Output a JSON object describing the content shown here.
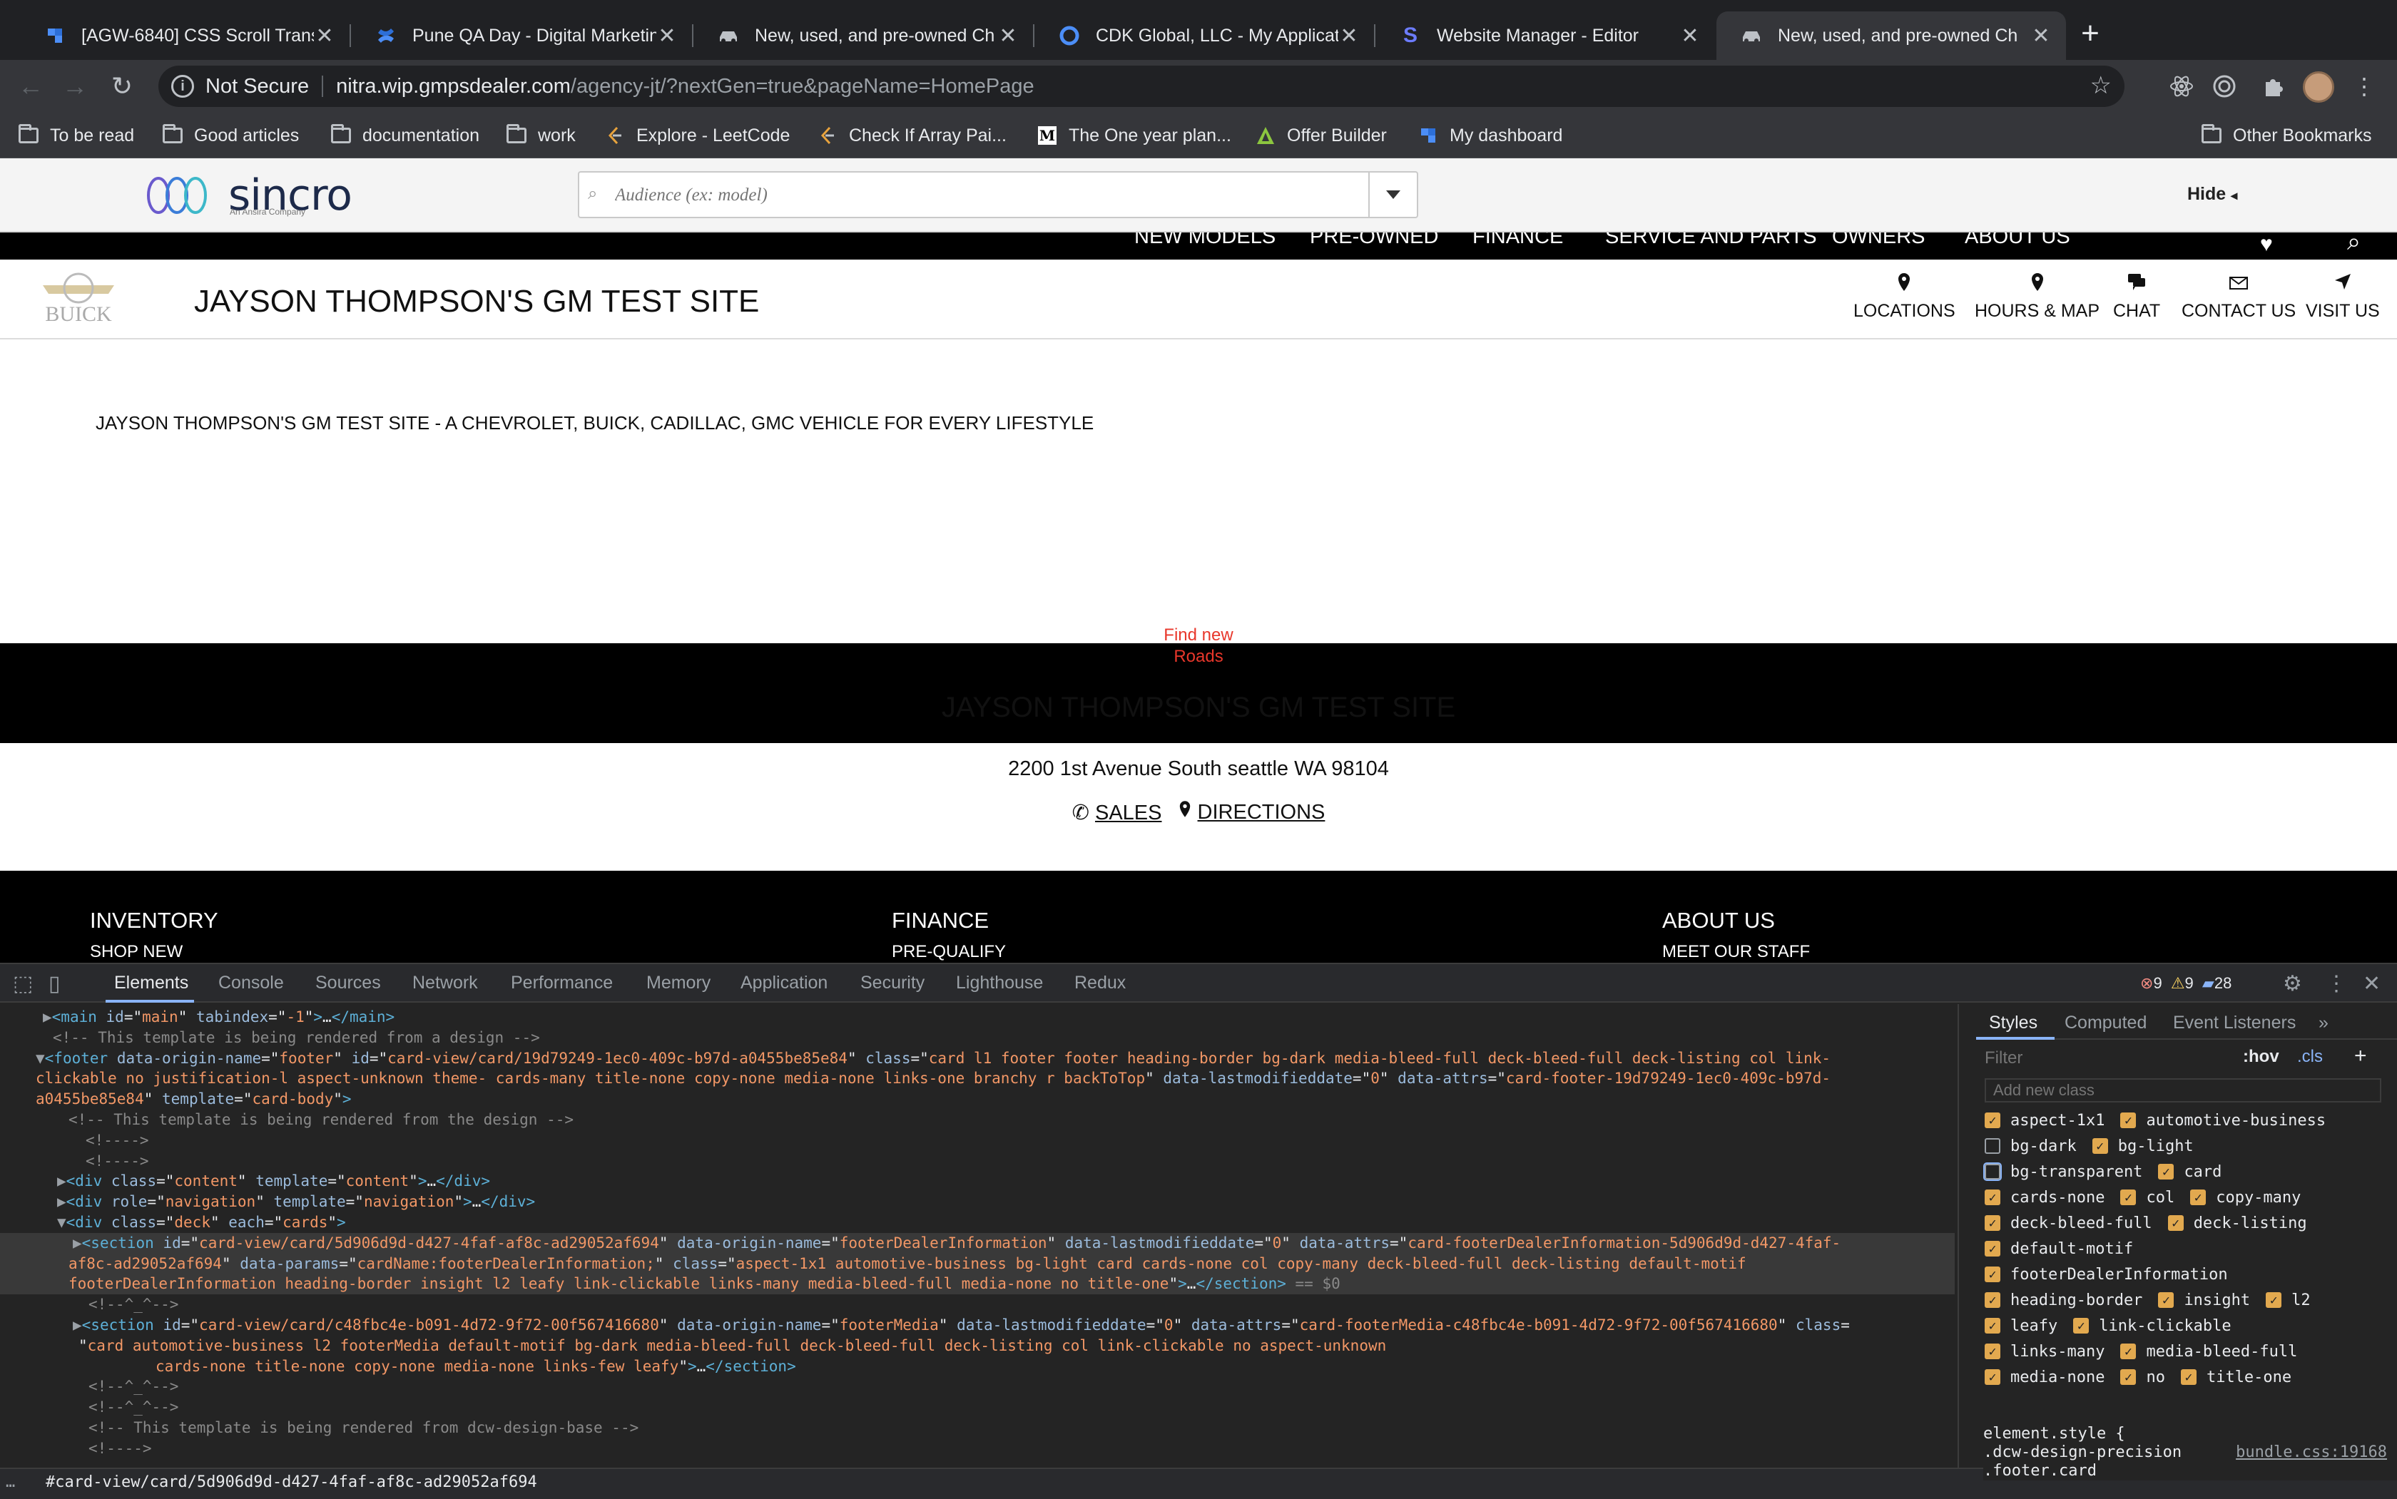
{
  "browser": {
    "tabs": [
      {
        "title": "[AGW-6840] CSS Scroll Transi",
        "favicon": "jira-icon"
      },
      {
        "title": "Pune QA Day - Digital Marketin",
        "favicon": "confluence-icon"
      },
      {
        "title": "New, used, and pre-owned Ch",
        "favicon": "car-icon"
      },
      {
        "title": "CDK Global, LLC - My Applicat",
        "favicon": "cdk-icon"
      },
      {
        "title": "Website Manager - Editor",
        "favicon": "s-logo-icon"
      },
      {
        "title": "New, used, and pre-owned Ch",
        "favicon": "car-icon",
        "active": true
      }
    ],
    "security_label": "Not Secure",
    "url_host": "nitra.wip.gmpsdealer.com",
    "url_path": "/agency-jt/?nextGen=true&pageName=HomePage",
    "bookmarks": [
      {
        "label": "To be read",
        "icon": "folder-icon"
      },
      {
        "label": "Good articles",
        "icon": "folder-icon"
      },
      {
        "label": "documentation",
        "icon": "folder-icon"
      },
      {
        "label": "work",
        "icon": "folder-icon"
      },
      {
        "label": "Explore - LeetCode",
        "icon": "leetcode-icon"
      },
      {
        "label": "Check If Array Pai...",
        "icon": "leetcode-icon"
      },
      {
        "label": "The One year plan...",
        "icon": "medium-icon"
      },
      {
        "label": "Offer Builder",
        "icon": "offer-builder-icon"
      },
      {
        "label": "My dashboard",
        "icon": "jira-icon"
      }
    ],
    "other_bookmarks": "Other Bookmarks"
  },
  "page": {
    "sincro_word": "sincro",
    "sincro_sub": "An Ansira Company",
    "audience_placeholder": "Audience (ex: model)",
    "hide_label": "Hide",
    "topnav": [
      "NEW MODELS",
      "PRE-OWNED",
      "FINANCE",
      "SERVICE AND PARTS",
      "OWNERS",
      "ABOUT US"
    ],
    "dealer_logo_text": "BUICK",
    "dealer_name": "JAYSON THOMPSON'S GM TEST SITE",
    "utility_links": [
      {
        "label": "LOCATIONS",
        "icon": "map-pin-icon"
      },
      {
        "label": "HOURS & MAP",
        "icon": "map-pin-icon"
      },
      {
        "label": "CHAT",
        "icon": "chat-icon"
      },
      {
        "label": "CONTACT US",
        "icon": "envelope-icon"
      },
      {
        "label": "VISIT US",
        "icon": "navigation-arrow-icon"
      }
    ],
    "tagline": "JAYSON THOMPSON'S GM TEST SITE - A CHEVROLET, BUICK, CADILLAC, GMC VEHICLE FOR EVERY LIFESTYLE",
    "find_new_line1": "Find new",
    "find_new_line2": "Roads",
    "info_name": "JAYSON THOMPSON'S GM TEST SITE",
    "address": "2200 1st Avenue South seattle WA 98104",
    "sales_label": "SALES",
    "directions_label": "DIRECTIONS",
    "footer_cols": [
      {
        "heading": "INVENTORY",
        "first_link": "SHOP NEW"
      },
      {
        "heading": "FINANCE",
        "first_link": "PRE-QUALIFY"
      },
      {
        "heading": "ABOUT US",
        "first_link": "MEET OUR STAFF"
      }
    ]
  },
  "devtools": {
    "tabs": [
      "Elements",
      "Console",
      "Sources",
      "Network",
      "Performance",
      "Memory",
      "Application",
      "Security",
      "Lighthouse",
      "Redux"
    ],
    "errors": "9",
    "warnings": "9",
    "messages": "28",
    "dom_lines": [
      [
        [
          "ar",
          "▶"
        ],
        [
          "tg",
          "<main "
        ],
        [
          "an",
          "id"
        ],
        [
          "tx",
          "=\""
        ],
        [
          "av",
          "main"
        ],
        [
          "tx",
          "\" "
        ],
        [
          "an",
          "tabindex"
        ],
        [
          "tx",
          "=\""
        ],
        [
          "av",
          "-1"
        ],
        [
          "tx",
          "\""
        ],
        [
          "tg",
          ">"
        ],
        [
          "tx",
          "…"
        ],
        [
          "tg",
          "</main>"
        ]
      ],
      [
        [
          "cm",
          "<!-- This template is being rendered from a design -->"
        ]
      ],
      [
        [
          "ar",
          "▼"
        ],
        [
          "tg",
          "<footer "
        ],
        [
          "an",
          "data-origin-name"
        ],
        [
          "tx",
          "=\""
        ],
        [
          "av",
          "footer"
        ],
        [
          "tx",
          "\" "
        ],
        [
          "an",
          "id"
        ],
        [
          "tx",
          "=\""
        ],
        [
          "av",
          "card-view/card/19d79249-1ec0-409c-b97d-a0455be85e84"
        ],
        [
          "tx",
          "\" "
        ],
        [
          "an",
          "class"
        ],
        [
          "tx",
          "=\""
        ],
        [
          "av",
          "card l1 footer footer heading-border bg-dark media-bleed-full deck-bleed-full deck-listing col link-"
        ]
      ],
      [
        [
          "av",
          "clickable no justification-l aspect-unknown theme- cards-many title-none copy-none media-none links-one branchy r backToTop"
        ],
        [
          "tx",
          "\" "
        ],
        [
          "an",
          "data-lastmodifieddate"
        ],
        [
          "tx",
          "=\""
        ],
        [
          "av",
          "0"
        ],
        [
          "tx",
          "\" "
        ],
        [
          "an",
          "data-attrs"
        ],
        [
          "tx",
          "=\""
        ],
        [
          "av",
          "card-footer-19d79249-1ec0-409c-b97d-"
        ]
      ],
      [
        [
          "av",
          "a0455be85e84"
        ],
        [
          "tx",
          "\" "
        ],
        [
          "an",
          "template"
        ],
        [
          "tx",
          "=\""
        ],
        [
          "av",
          "card-body"
        ],
        [
          "tx",
          "\""
        ],
        [
          "tg",
          ">"
        ]
      ],
      [
        [
          "cm",
          "<!-- This template is being rendered from the design -->"
        ]
      ],
      [
        [
          "cm",
          "<!---->"
        ]
      ],
      [
        [
          "cm",
          "<!---->"
        ]
      ],
      [
        [
          "ar",
          "▶"
        ],
        [
          "tg",
          "<div "
        ],
        [
          "an",
          "class"
        ],
        [
          "tx",
          "=\""
        ],
        [
          "av",
          "content"
        ],
        [
          "tx",
          "\" "
        ],
        [
          "an",
          "template"
        ],
        [
          "tx",
          "=\""
        ],
        [
          "av",
          "content"
        ],
        [
          "tx",
          "\""
        ],
        [
          "tg",
          ">"
        ],
        [
          "tx",
          "…"
        ],
        [
          "tg",
          "</div>"
        ]
      ],
      [
        [
          "ar",
          "▶"
        ],
        [
          "tg",
          "<div "
        ],
        [
          "an",
          "role"
        ],
        [
          "tx",
          "=\""
        ],
        [
          "av",
          "navigation"
        ],
        [
          "tx",
          "\" "
        ],
        [
          "an",
          "template"
        ],
        [
          "tx",
          "=\""
        ],
        [
          "av",
          "navigation"
        ],
        [
          "tx",
          "\""
        ],
        [
          "tg",
          ">"
        ],
        [
          "tx",
          "…"
        ],
        [
          "tg",
          "</div>"
        ]
      ],
      [
        [
          "ar",
          "▼"
        ],
        [
          "tg",
          "<div "
        ],
        [
          "an",
          "class"
        ],
        [
          "tx",
          "=\""
        ],
        [
          "av",
          "deck"
        ],
        [
          "tx",
          "\" "
        ],
        [
          "an",
          "each"
        ],
        [
          "tx",
          "=\""
        ],
        [
          "av",
          "cards"
        ],
        [
          "tx",
          "\""
        ],
        [
          "tg",
          ">"
        ]
      ],
      [
        [
          "ar",
          "▶"
        ],
        [
          "tg",
          "<section "
        ],
        [
          "an",
          "id"
        ],
        [
          "tx",
          "=\""
        ],
        [
          "av",
          "card-view/card/5d906d9d-d427-4faf-af8c-ad29052af694"
        ],
        [
          "tx",
          "\" "
        ],
        [
          "an",
          "data-origin-name"
        ],
        [
          "tx",
          "=\""
        ],
        [
          "av",
          "footerDealerInformation"
        ],
        [
          "tx",
          "\" "
        ],
        [
          "an",
          "data-lastmodifieddate"
        ],
        [
          "tx",
          "=\""
        ],
        [
          "av",
          "0"
        ],
        [
          "tx",
          "\" "
        ],
        [
          "an",
          "data-attrs"
        ],
        [
          "tx",
          "=\""
        ],
        [
          "av",
          "card-footerDealerInformation-5d906d9d-d427-4faf-"
        ]
      ],
      [
        [
          "av",
          "af8c-ad29052af694"
        ],
        [
          "tx",
          "\" "
        ],
        [
          "an",
          "data-params"
        ],
        [
          "tx",
          "=\""
        ],
        [
          "av",
          "cardName:footerDealerInformation;"
        ],
        [
          "tx",
          "\" "
        ],
        [
          "an",
          "class"
        ],
        [
          "tx",
          "=\""
        ],
        [
          "av",
          "aspect-1x1 automotive-business bg-light card cards-none col copy-many deck-bleed-full deck-listing default-motif"
        ]
      ],
      [
        [
          "av",
          "footerDealerInformation heading-border insight l2 leafy link-clickable links-many media-bleed-full media-none no title-one"
        ],
        [
          "tx",
          "\""
        ],
        [
          "tg",
          ">"
        ],
        [
          "tx",
          "…"
        ],
        [
          "tg",
          "</section>"
        ],
        [
          "cm",
          " == $0"
        ]
      ],
      [
        [
          "cm",
          "<!--^_^-->"
        ]
      ],
      [
        [
          "ar",
          "▶"
        ],
        [
          "tg",
          "<section "
        ],
        [
          "an",
          "id"
        ],
        [
          "tx",
          "=\""
        ],
        [
          "av",
          "card-view/card/c48fbc4e-b091-4d72-9f72-00f567416680"
        ],
        [
          "tx",
          "\" "
        ],
        [
          "an",
          "data-origin-name"
        ],
        [
          "tx",
          "=\""
        ],
        [
          "av",
          "footerMedia"
        ],
        [
          "tx",
          "\" "
        ],
        [
          "an",
          "data-lastmodifieddate"
        ],
        [
          "tx",
          "=\""
        ],
        [
          "av",
          "0"
        ],
        [
          "tx",
          "\" "
        ],
        [
          "an",
          "data-attrs"
        ],
        [
          "tx",
          "=\""
        ],
        [
          "av",
          "card-footerMedia-c48fbc4e-b091-4d72-9f72-00f567416680"
        ],
        [
          "tx",
          "\" "
        ],
        [
          "an",
          "class"
        ],
        [
          "tx",
          "="
        ]
      ],
      [
        [
          "tx",
          "\""
        ],
        [
          "av",
          "card automotive-business l2 footerMedia default-motif bg-dark media-bleed-full deck-bleed-full deck-listing col link-clickable no aspect-unknown"
        ]
      ],
      [
        [
          "av",
          "cards-none title-none copy-none media-none links-few leafy"
        ],
        [
          "tx",
          "\""
        ],
        [
          "tg",
          ">"
        ],
        [
          "tx",
          "…"
        ],
        [
          "tg",
          "</section>"
        ]
      ],
      [
        [
          "cm",
          "<!--^_^-->"
        ]
      ],
      [
        [
          "cm",
          "<!--^_^-->"
        ]
      ],
      [
        [
          "cm",
          "<!-- This template is being rendered from dcw-design-base -->"
        ]
      ],
      [
        [
          "cm",
          "<!---->"
        ]
      ]
    ],
    "styles_tabs": [
      "Styles",
      "Computed",
      "Event Listeners"
    ],
    "filter_placeholder": "Filter",
    "hov_label": ":hov",
    "cls_label": ".cls",
    "add_class_placeholder": "Add new class",
    "class_rows": [
      [
        {
          "name": "aspect-1x1",
          "checked": true
        },
        {
          "name": "automotive-business",
          "checked": true
        }
      ],
      [
        {
          "name": "bg-dark",
          "checked": false
        },
        {
          "name": "bg-light",
          "checked": true
        }
      ],
      [
        {
          "name": "bg-transparent",
          "checked": false
        },
        {
          "name": "card",
          "checked": true
        }
      ],
      [
        {
          "name": "cards-none",
          "checked": true
        },
        {
          "name": "col",
          "checked": true
        },
        {
          "name": "copy-many",
          "checked": true
        }
      ],
      [
        {
          "name": "deck-bleed-full",
          "checked": true
        },
        {
          "name": "deck-listing",
          "checked": true
        }
      ],
      [
        {
          "name": "default-motif",
          "checked": true
        }
      ],
      [
        {
          "name": "footerDealerInformation",
          "checked": true
        }
      ],
      [
        {
          "name": "heading-border",
          "checked": true
        },
        {
          "name": "insight",
          "checked": true
        },
        {
          "name": "l2",
          "checked": true
        }
      ],
      [
        {
          "name": "leafy",
          "checked": true
        },
        {
          "name": "link-clickable",
          "checked": true
        }
      ],
      [
        {
          "name": "links-many",
          "checked": true
        },
        {
          "name": "media-bleed-full",
          "checked": true
        }
      ],
      [
        {
          "name": "media-none",
          "checked": true
        },
        {
          "name": "no",
          "checked": true
        },
        {
          "name": "title-one",
          "checked": true
        }
      ]
    ],
    "element_style_open": "element.style {",
    "element_style_close": "}",
    "rule_selector": ".dcw-design-precision",
    "rule_source": "bundle.css:19168",
    "rule_selector2": ".footer.card",
    "breadcrumb": "#card-view/card/5d906d9d-d427-4faf-af8c-ad29052af694"
  }
}
